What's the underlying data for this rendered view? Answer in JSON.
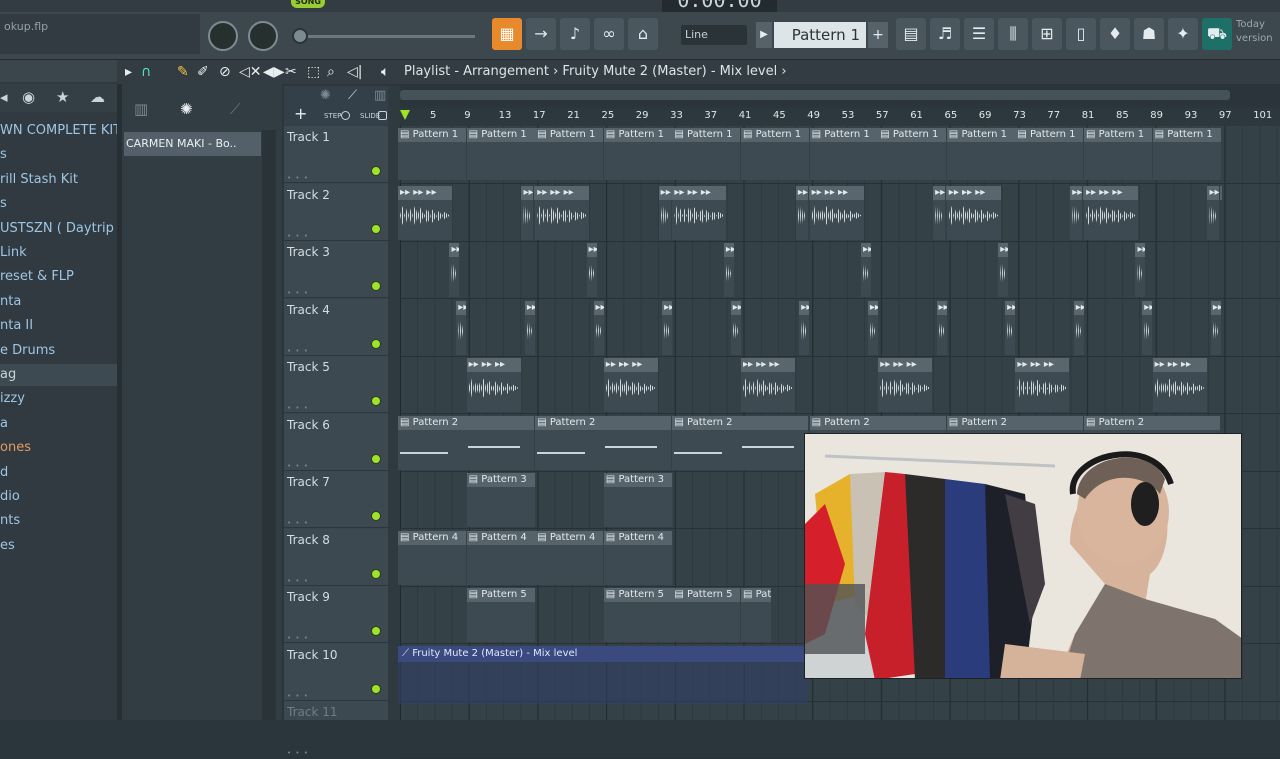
{
  "topbar": {
    "song_label": "SONG",
    "time": "0:00:00",
    "filename": "okup.flp",
    "snap": "Line",
    "pattern": "Pattern 1",
    "hint_line1": "Today",
    "hint_line2": "version"
  },
  "browser": {
    "items": [
      {
        "label": "WN COMPLETE KIT III",
        "style": "blue"
      },
      {
        "label": "s",
        "style": "blue"
      },
      {
        "label": "rill Stash Kit",
        "style": "blue"
      },
      {
        "label": "s",
        "style": "blue"
      },
      {
        "label": "USTSZN ( Daytrip )",
        "style": "blue"
      },
      {
        "label": "Link",
        "style": "blue"
      },
      {
        "label": "reset & FLP",
        "style": "blue"
      },
      {
        "label": "nta",
        "style": "blue"
      },
      {
        "label": "nta II",
        "style": "blue"
      },
      {
        "label": "e Drums",
        "style": "blue"
      },
      {
        "label": "ag",
        "style": "selected"
      },
      {
        "label": "izzy",
        "style": "blue"
      },
      {
        "label": "a",
        "style": "blue"
      },
      {
        "label": "ones",
        "style": "orange"
      },
      {
        "label": "d",
        "style": "blue"
      },
      {
        "label": "dio",
        "style": "blue"
      },
      {
        "label": "nts",
        "style": "blue"
      },
      {
        "label": "es",
        "style": "blue"
      }
    ]
  },
  "channel": {
    "item": "CARMEN MAKI - Bo.."
  },
  "playlist": {
    "breadcrumb": "Playlist - Arrangement  ›  Fruity Mute 2 (Master) - Mix level  ›",
    "step_label": "STEP",
    "slide_label": "SLIDE",
    "ruler_ticks": [
      "5",
      "9",
      "13",
      "17",
      "21",
      "25",
      "29",
      "33",
      "37",
      "41",
      "45",
      "49",
      "53",
      "57",
      "61",
      "65",
      "69",
      "73",
      "77",
      "81",
      "85",
      "89",
      "93",
      "97",
      "101"
    ],
    "tracks": [
      "Track 1",
      "Track 2",
      "Track 3",
      "Track 4",
      "Track 5",
      "Track 6",
      "Track 7",
      "Track 8",
      "Track 9",
      "Track 10",
      "Track 11"
    ],
    "clip_labels": {
      "p1": "Pattern 1",
      "p2": "Pattern 2",
      "p3": "Pattern 3",
      "p4": "Pattern 4",
      "p5": "Pattern 5"
    },
    "automation_label": "Fruity Mute 2 (Master) - Mix level"
  },
  "colors": {
    "accent": "#e88a2b",
    "track_led": "#9ee32a",
    "automation": "#3a4a7e"
  }
}
